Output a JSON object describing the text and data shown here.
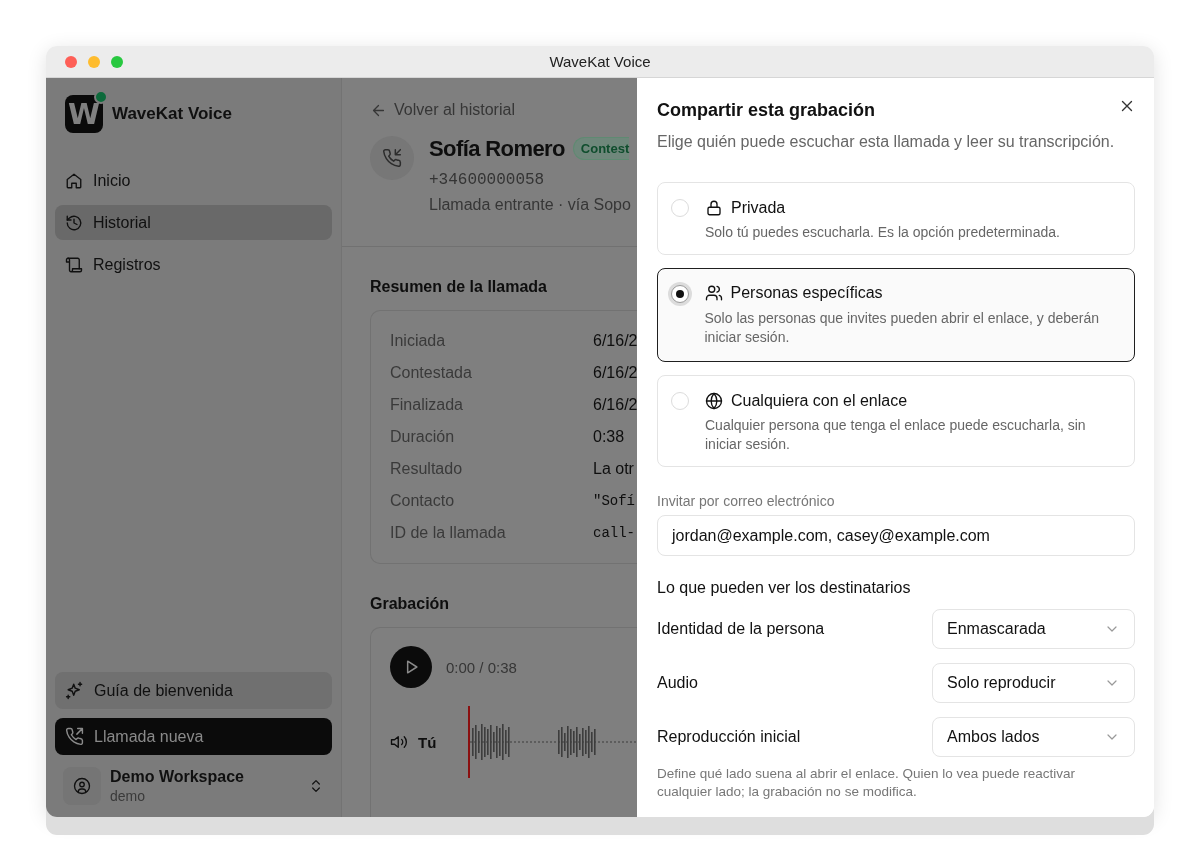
{
  "window": {
    "title": "WaveKat Voice"
  },
  "sidebar": {
    "logo_letter": "W",
    "brand": "WaveKat Voice",
    "nav": [
      {
        "label": "Inicio",
        "selected": false
      },
      {
        "label": "Historial",
        "selected": true
      },
      {
        "label": "Registros",
        "selected": false
      }
    ],
    "onboarding": "Guía de bienvenida",
    "new_call": "Llamada nueva",
    "workspace": {
      "name": "Demo Workspace",
      "slug": "demo"
    }
  },
  "call": {
    "back": "Volver al historial",
    "name": "Sofía Romero",
    "status": "Contest",
    "phone": "+34600000058",
    "meta": "Llamada entrante · vía Sopo",
    "summary": {
      "title": "Resumen de la llamada",
      "rows": [
        {
          "label": "Iniciada",
          "value": "6/16/2",
          "kind": "text"
        },
        {
          "label": "Contestada",
          "value": "6/16/2",
          "kind": "text"
        },
        {
          "label": "Finalizada",
          "value": "6/16/2",
          "kind": "text"
        },
        {
          "label": "Duración",
          "value": "0:38",
          "kind": "text"
        },
        {
          "label": "Resultado",
          "value": "La otr",
          "kind": "text"
        },
        {
          "label": "Contacto",
          "value": "\"Sofí",
          "kind": "mono"
        },
        {
          "label": "ID de la llamada",
          "value": "call-",
          "kind": "mono"
        }
      ]
    },
    "recording": {
      "title": "Grabación",
      "time": "0:00 / 0:38",
      "tracks": [
        {
          "label": "Tú"
        }
      ]
    }
  },
  "share": {
    "title": "Compartir esta grabación",
    "subtitle": "Elige quién puede escuchar esta llamada y leer su transcripción.",
    "options": [
      {
        "label": "Privada",
        "description": "Solo tú puedes escucharla. Es la opción predeterminada.",
        "selected": false
      },
      {
        "label": "Personas específicas",
        "description": "Solo las personas que invites pueden abrir el enlace, y deberán iniciar sesión.",
        "selected": true
      },
      {
        "label": "Cualquiera con el enlace",
        "description": "Cualquier persona que tenga el enlace puede escucharla, sin iniciar sesión.",
        "selected": false
      }
    ],
    "invite": {
      "label": "Invitar por correo electrónico",
      "value": "jordan@example.com, casey@example.com"
    },
    "section": "Lo que pueden ver los destinatarios",
    "settings": [
      {
        "label": "Identidad de la persona",
        "value": "Enmascarada"
      },
      {
        "label": "Audio",
        "value": "Solo reproducir"
      },
      {
        "label": "Reproducción inicial",
        "value": "Ambos lados"
      }
    ],
    "help": "Define qué lado suena al abrir el enlace. Quien lo vea puede reactivar cualquier lado; la grabación no se modifica."
  }
}
